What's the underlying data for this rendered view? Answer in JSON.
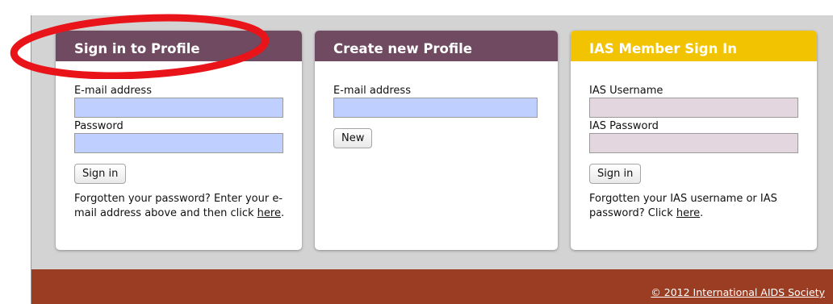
{
  "signin": {
    "title": "Sign in to Profile",
    "email_label": "E-mail address",
    "email_value": "",
    "password_label": "Password",
    "password_value": "",
    "button": "Sign in",
    "forgot_text_1": "Forgotten your password? Enter your e-mail address above and then click ",
    "forgot_link": "here",
    "forgot_text_2": "."
  },
  "create": {
    "title": "Create new Profile",
    "email_label": "E-mail address",
    "email_value": "",
    "button": "New"
  },
  "ias": {
    "title": "IAS Member Sign In",
    "username_label": "IAS Username",
    "username_value": "",
    "password_label": "IAS Password",
    "password_value": "",
    "button": "Sign in",
    "forgot_text_1": "Forgotten your IAS username or IAS password? Click ",
    "forgot_link": "here",
    "forgot_text_2": "."
  },
  "footer": {
    "copyright": "© 2012 International AIDS Society"
  },
  "colors": {
    "header_purple": "#6f4a60",
    "header_yellow": "#f2c300",
    "footer_brown": "#9b3d22",
    "input_blue": "#bfcfff",
    "input_pink": "#e3d6df",
    "annotation_red": "#e8141a"
  }
}
